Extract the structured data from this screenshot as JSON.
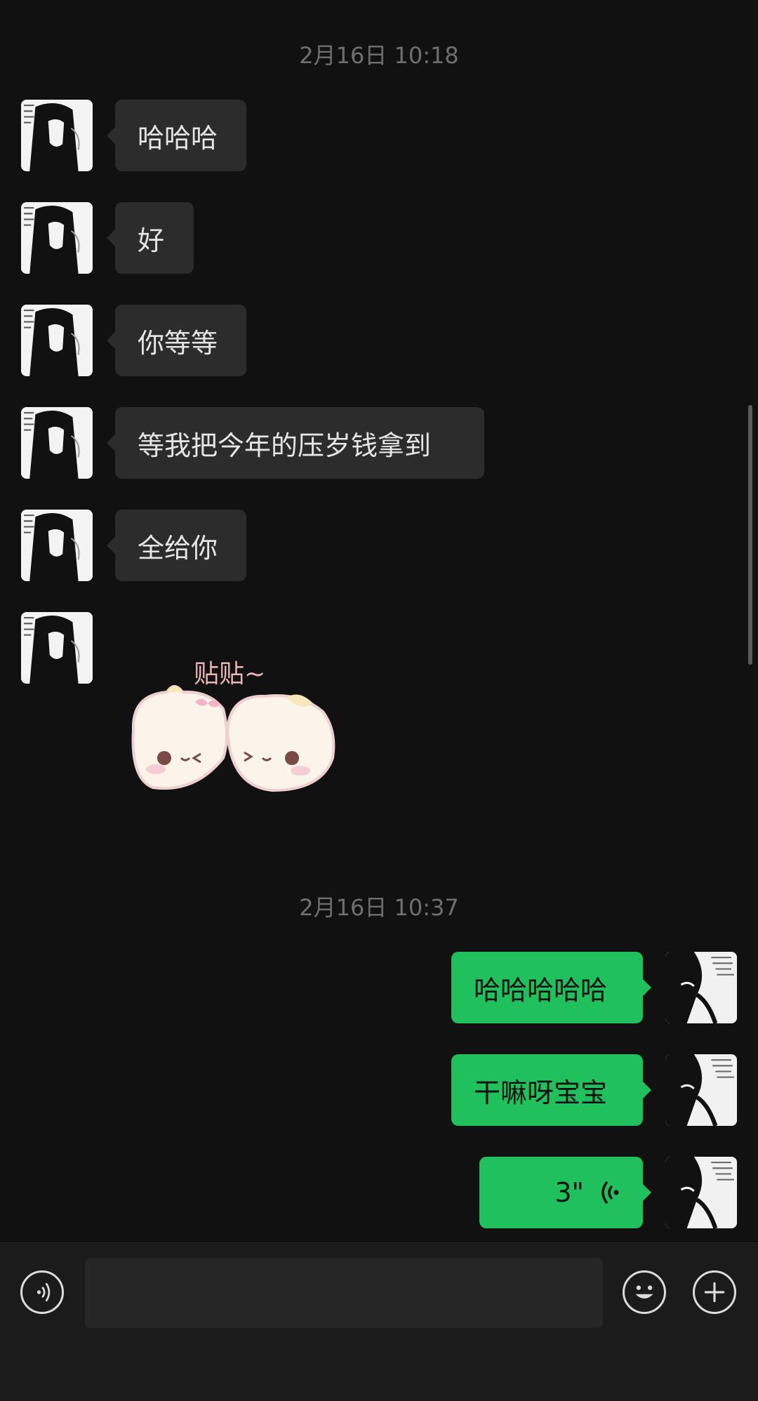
{
  "chat": {
    "timestamps": [
      "2月16日 10:18",
      "2月16日 10:37"
    ],
    "incoming": [
      "哈哈哈",
      "好",
      "你等等",
      "等我把今年的压岁钱拿到",
      "全给你"
    ],
    "sticker": {
      "caption": "贴贴~",
      "icon": "hugging-cats-sticker"
    },
    "outgoing": [
      "哈哈哈哈哈",
      "干嘛呀宝宝"
    ],
    "voice": {
      "duration": "3\"",
      "icon": "voice-wave-icon"
    }
  },
  "input_bar": {
    "voice_toggle_icon": "voice-mode-icon",
    "text_value": "",
    "emoji_icon": "emoji-icon",
    "more_icon": "plus-icon"
  },
  "colors": {
    "background": "#111111",
    "incoming_bubble": "#2c2c2c",
    "outgoing_bubble": "#20c05c",
    "timestamp_text": "#6f6f6f"
  }
}
